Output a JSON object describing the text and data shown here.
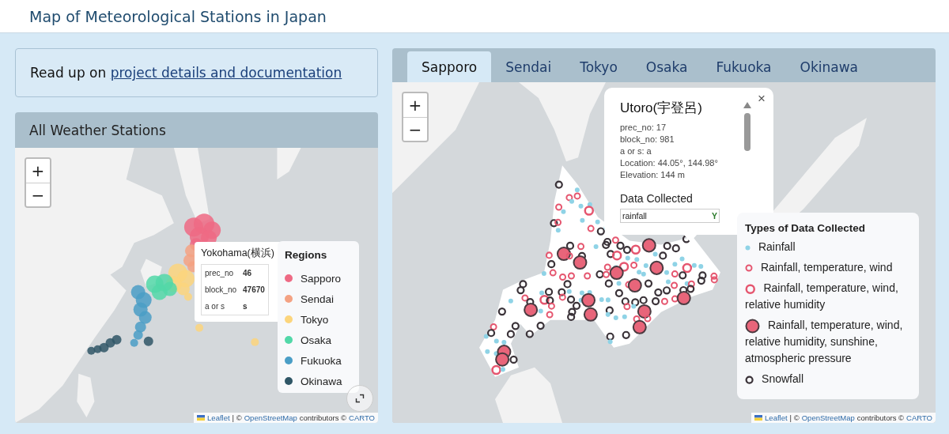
{
  "header": {
    "title": "Map of Meteorological Stations in Japan"
  },
  "intro": {
    "text": "Read up on",
    "link": "project details and documentation"
  },
  "overview": {
    "title": "All Weather Stations",
    "zoom_in": "+",
    "zoom_out": "−",
    "popup": {
      "title": "Yokohama(横浜)",
      "rows": [
        {
          "label": "prec_no",
          "value": "46"
        },
        {
          "label": "block_no",
          "value": "47670"
        },
        {
          "label": "a or s",
          "value": "s"
        }
      ]
    },
    "legend": {
      "title": "Regions",
      "items": [
        {
          "label": "Sapporo",
          "color": "#ee6a84"
        },
        {
          "label": "Sendai",
          "color": "#f4a283"
        },
        {
          "label": "Tokyo",
          "color": "#fcd57c"
        },
        {
          "label": "Osaka",
          "color": "#52d8a8"
        },
        {
          "label": "Fukuoka",
          "color": "#4a9ec6"
        },
        {
          "label": "Okinawa",
          "color": "#2f5666"
        }
      ]
    },
    "attribution": [
      {
        "kind": "link",
        "text": "Leaflet"
      },
      {
        "kind": "text",
        "text": "| ©"
      },
      {
        "kind": "link",
        "text": "OpenStreetMap"
      },
      {
        "kind": "text",
        "text": "contributors ©"
      },
      {
        "kind": "link",
        "text": "CARTO"
      }
    ]
  },
  "region_tabs": [
    {
      "label": "Sapporo",
      "selected": true
    },
    {
      "label": "Sendai",
      "selected": false
    },
    {
      "label": "Tokyo",
      "selected": false
    },
    {
      "label": "Osaka",
      "selected": false
    },
    {
      "label": "Fukuoka",
      "selected": false
    },
    {
      "label": "Okinawa",
      "selected": false
    }
  ],
  "region_map": {
    "zoom_in": "+",
    "zoom_out": "−",
    "popup": {
      "title": "Utoro(宇登呂)",
      "close": "×",
      "lines": [
        "prec_no: 17",
        "block_no: 981",
        "a or s: a",
        "Location: 44.05°, 144.98°",
        "Elevation: 144 m"
      ],
      "section_title": "Data Collected",
      "field": {
        "label": "rainfall",
        "value": "Y"
      }
    },
    "legend": {
      "title": "Types of Data Collected",
      "items": [
        {
          "kind": "rain",
          "label": "Rainfall"
        },
        {
          "kind": "basic",
          "label": "Rainfall, temperature, wind"
        },
        {
          "kind": "humidity",
          "label": "Rainfall, temperature, wind, relative humidity"
        },
        {
          "kind": "full",
          "label": "Rainfall, temperature, wind, relative humidity, sunshine, atmospheric pressure"
        },
        {
          "kind": "snow",
          "label": "Snowfall"
        }
      ]
    },
    "attribution": [
      {
        "kind": "link",
        "text": "Leaflet"
      },
      {
        "kind": "text",
        "text": "| ©"
      },
      {
        "kind": "link",
        "text": "OpenStreetMap"
      },
      {
        "kind": "text",
        "text": "contributors ©"
      },
      {
        "kind": "link",
        "text": "CARTO"
      }
    ]
  }
}
